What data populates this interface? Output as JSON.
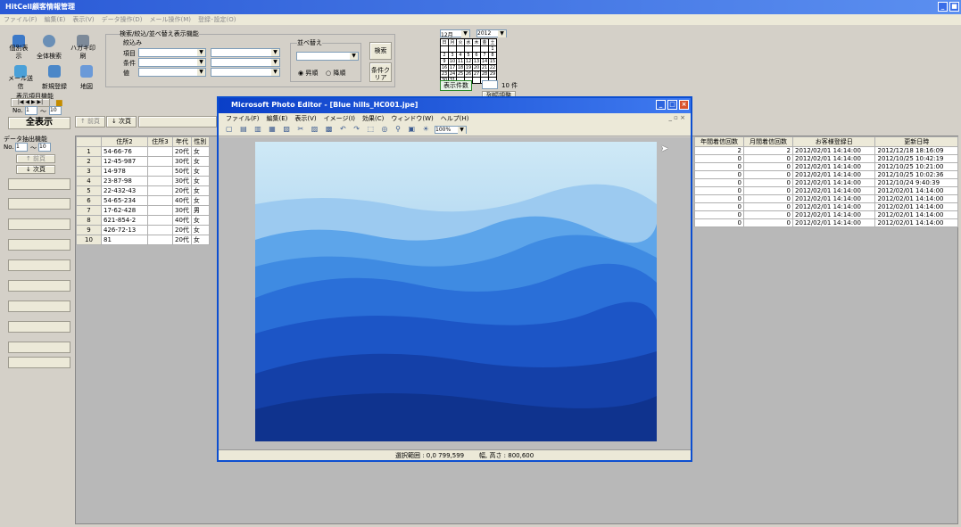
{
  "app": {
    "title": "HitCell顧客情報管理",
    "controls": [
      "_",
      "■"
    ]
  },
  "menu": [
    "ファイル(F)",
    "編集(E)",
    "表示(V)",
    "データ操作(D)",
    "メール操作(M)",
    "登録･設定(O)"
  ],
  "toolbar": [
    {
      "label": "個別表示",
      "icon": "card-icon",
      "color": "#3c79c8"
    },
    {
      "label": "全体検索",
      "icon": "magnifier-icon",
      "color": "#6a8fb6"
    },
    {
      "label": "ハガキ印刷",
      "icon": "printer-icon",
      "color": "#7d8a99"
    },
    {
      "label": "メール送信",
      "icon": "mail-icon",
      "color": "#4aa0d8"
    },
    {
      "label": "新規登録",
      "icon": "new-record-icon",
      "color": "#4b87c8"
    },
    {
      "label": "地図",
      "icon": "map-icon",
      "color": "#6b9ad8"
    }
  ],
  "search": {
    "group_title": "検索/絞込/並べ替え表示機能",
    "narrow": "絞込み",
    "item": "項目",
    "cond": "条件",
    "val": "値",
    "sort_title": "並べ替え",
    "search_btn": "検索",
    "clear_btn": "条件クリア",
    "asc": "昇順",
    "desc": "降順"
  },
  "calendar": {
    "month": "12月",
    "year": "2012",
    "days": [
      "日",
      "月",
      "火",
      "水",
      "木",
      "金",
      "土"
    ],
    "weeks": [
      [
        "",
        "",
        "",
        "",
        "",
        "",
        "1"
      ],
      [
        "2",
        "3",
        "4",
        "5",
        "6",
        "7",
        "8"
      ],
      [
        "9",
        "10",
        "11",
        "12",
        "13",
        "14",
        "15"
      ],
      [
        "16",
        "17",
        "18",
        "19",
        "20",
        "21",
        "22"
      ],
      [
        "23",
        "24",
        "25",
        "26",
        "27",
        "28",
        "29"
      ],
      [
        "30",
        "31",
        "",
        "",
        "",
        "",
        ""
      ]
    ]
  },
  "count": {
    "label": "表示件数",
    "value": "10 件",
    "col_adjust": "列幅調整"
  },
  "display": {
    "title": "表示項目機能",
    "no_label": "No.",
    "no_from": "1",
    "tilde": "〜",
    "no_to": "10",
    "prev": "↑ 前頁",
    "next": "↓ 次頁",
    "all": "全表示"
  },
  "extract": {
    "title": "データ抽出機能",
    "no_label": "No.",
    "no_from": "1",
    "tilde": "〜",
    "no_to": "10",
    "prev": "↑ 前頁",
    "next": "↓ 次頁"
  },
  "table_left": {
    "headers": [
      "",
      "住所2",
      "住所3",
      "年代",
      "性別"
    ],
    "rows": [
      [
        "1",
        "54-66-76",
        "",
        "20代",
        "女"
      ],
      [
        "2",
        "12-45-987",
        "",
        "30代",
        "女"
      ],
      [
        "3",
        "14-978",
        "",
        "50代",
        "女"
      ],
      [
        "4",
        "23-87-98",
        "",
        "30代",
        "女"
      ],
      [
        "5",
        "22-432-43",
        "",
        "20代",
        "女"
      ],
      [
        "6",
        "54-65-234",
        "",
        "40代",
        "女"
      ],
      [
        "7",
        "17-62-428",
        "",
        "30代",
        "男"
      ],
      [
        "8",
        "621-854-2",
        "",
        "40代",
        "女"
      ],
      [
        "9",
        "426-72-13",
        "",
        "20代",
        "女"
      ],
      [
        "10",
        "81",
        "",
        "20代",
        "女"
      ]
    ]
  },
  "table_right": {
    "headers": [
      "年間着信回数",
      "月間着信回数",
      "お客様登録日",
      "更新日時"
    ],
    "rows": [
      [
        "2",
        "2",
        "2012/02/01 14:14:00",
        "2012/12/18 18:16:09"
      ],
      [
        "0",
        "0",
        "2012/02/01 14:14:00",
        "2012/10/25 10:42:19"
      ],
      [
        "0",
        "0",
        "2012/02/01 14:14:00",
        "2012/10/25 10:21:00"
      ],
      [
        "0",
        "0",
        "2012/02/01 14:14:00",
        "2012/10/25 10:02:36"
      ],
      [
        "0",
        "0",
        "2012/02/01 14:14:00",
        "2012/10/24 9:40:39"
      ],
      [
        "0",
        "0",
        "2012/02/01 14:14:00",
        "2012/02/01 14:14:00"
      ],
      [
        "0",
        "0",
        "2012/02/01 14:14:00",
        "2012/02/01 14:14:00"
      ],
      [
        "0",
        "0",
        "2012/02/01 14:14:00",
        "2012/02/01 14:14:00"
      ],
      [
        "0",
        "0",
        "2012/02/01 14:14:00",
        "2012/02/01 14:14:00"
      ],
      [
        "0",
        "0",
        "2012/02/01 14:14:00",
        "2012/02/01 14:14:00"
      ]
    ]
  },
  "photo_editor": {
    "title": "Microsoft Photo Editor - [Blue hills_HC001.jpe]",
    "menu": [
      "ファイル(F)",
      "編集(E)",
      "表示(V)",
      "イメージ(I)",
      "効果(C)",
      "ウィンドウ(W)",
      "ヘルプ(H)"
    ],
    "zoom": "100%",
    "status_sel": "選択範囲 : 0,0 799,599",
    "status_size": "幅, 高さ : 800,600"
  }
}
